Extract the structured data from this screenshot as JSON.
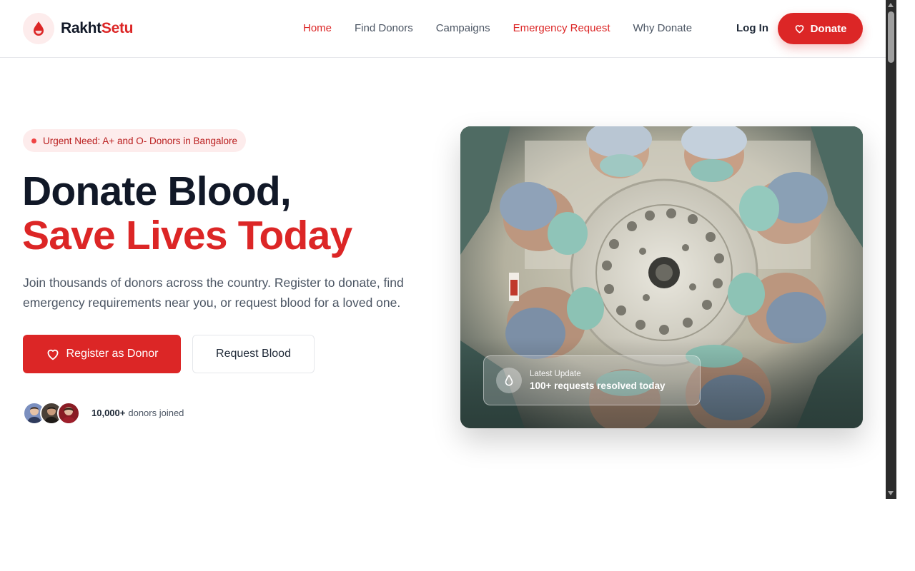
{
  "brand": {
    "name_part1": "Rakht",
    "name_part2": "Setu",
    "accent": "#dc2626"
  },
  "nav": {
    "items": [
      {
        "label": "Home",
        "active": true
      },
      {
        "label": "Find Donors"
      },
      {
        "label": "Campaigns"
      },
      {
        "label": "Emergency Request",
        "highlight": true
      },
      {
        "label": "Why Donate"
      }
    ],
    "login_label": "Log In",
    "donate_label": "Donate"
  },
  "hero": {
    "badge": "Urgent Need: A+ and O- Donors in Bangalore",
    "title_line1": "Donate Blood,",
    "title_line2": "Save Lives Today",
    "subtitle": "Join thousands of donors across the country. Register to donate, find emergency requirements near you, or request blood for a loved one.",
    "primary_cta": "Register as Donor",
    "secondary_cta": "Request Blood",
    "donor_count": "10,000+",
    "donor_suffix": "donors joined"
  },
  "update_card": {
    "label": "Latest Update",
    "value": "100+ requests resolved today"
  },
  "icons": {
    "logo": "blood-drop-icon",
    "donate": "heart-icon",
    "register": "heart-icon",
    "update": "droplet-icon"
  }
}
